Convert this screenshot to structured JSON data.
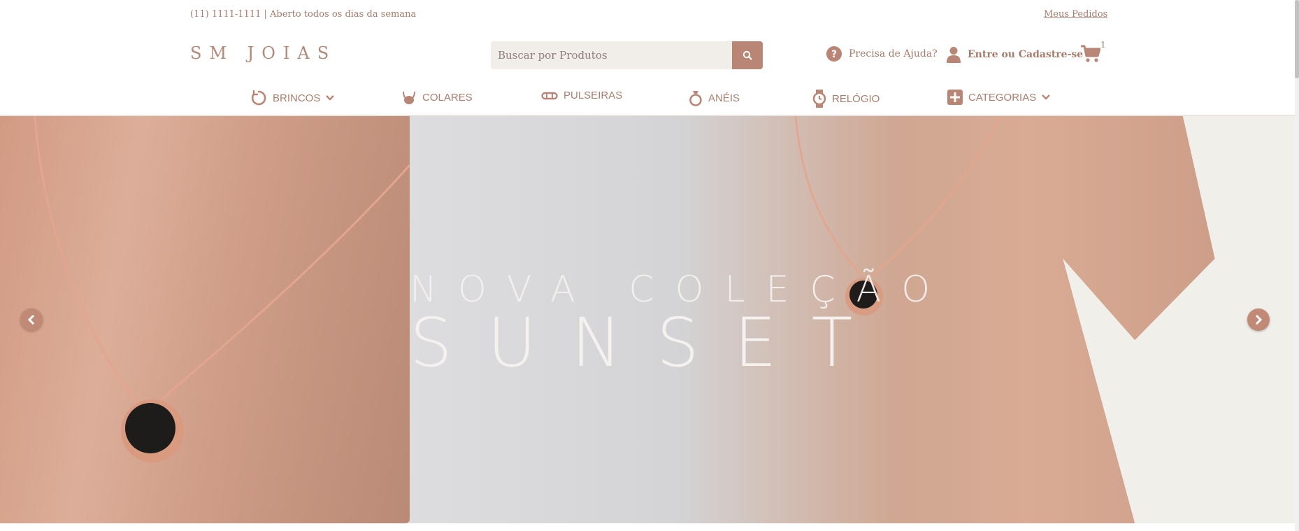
{
  "topbar": {
    "contact": "(11) 1111-1111 | Aberto todos os dias da semana",
    "orders_link": "Meus Pedidos"
  },
  "brand": {
    "logo_text": "SM JOIAS"
  },
  "search": {
    "placeholder": "Buscar por Produtos",
    "button_icon": "search-icon"
  },
  "header_actions": {
    "help_label": "Precisa de Ajuda?",
    "login_label": "Entre ou Cadastre-se",
    "cart_count": "1"
  },
  "nav": {
    "items": [
      {
        "label": "BRINCOS",
        "icon": "earring-icon",
        "has_dropdown": true
      },
      {
        "label": "COLARES",
        "icon": "necklace-icon",
        "has_dropdown": false
      },
      {
        "label": "PULSEIRAS",
        "icon": "bracelet-icon",
        "has_dropdown": false
      },
      {
        "label": "ANÉIS",
        "icon": "ring-icon",
        "has_dropdown": false
      },
      {
        "label": "RELÓGIO",
        "icon": "watch-icon",
        "has_dropdown": false
      },
      {
        "label": "CATEGORIAS",
        "icon": "plus-square-icon",
        "has_dropdown": true
      }
    ]
  },
  "banner": {
    "line1": "NOVA COLEÇÃO",
    "line2": "SUNSET"
  },
  "colors": {
    "accent": "#b98574",
    "text": "#a57c6c",
    "search_bg": "#f1ede9"
  }
}
